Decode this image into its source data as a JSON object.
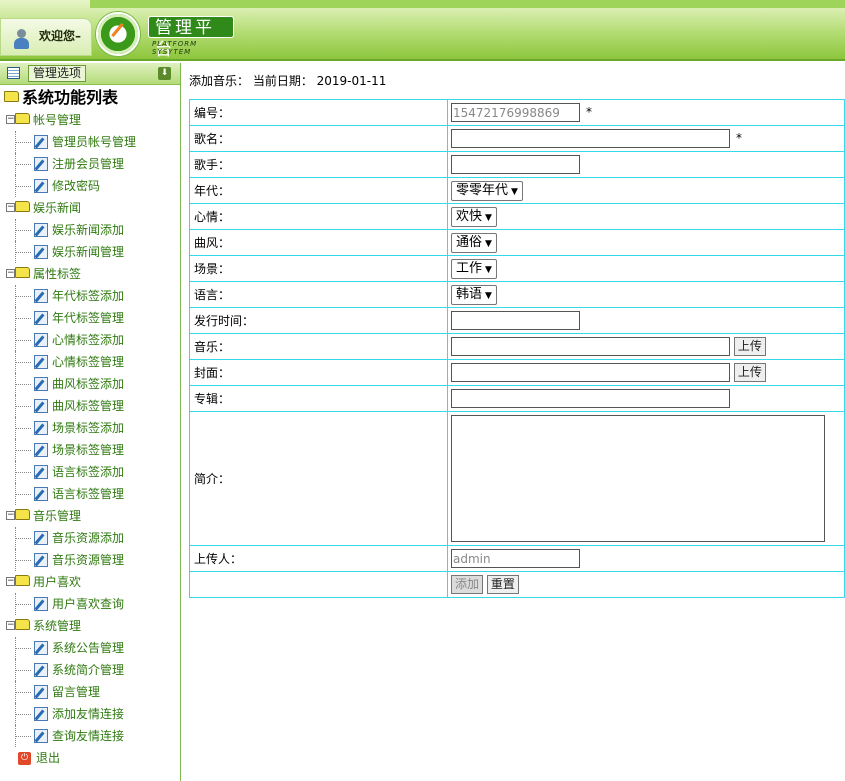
{
  "header": {
    "welcome": "欢迎您–",
    "brand_title": "管理平台",
    "brand_subtitle": "PLATFORM SYSYTEM"
  },
  "sidebar": {
    "title": "管理选项",
    "root": "系统功能列表",
    "groups": [
      {
        "label": "帐号管理",
        "items": [
          "管理员帐号管理",
          "注册会员管理",
          "修改密码"
        ]
      },
      {
        "label": "娱乐新闻",
        "items": [
          "娱乐新闻添加",
          "娱乐新闻管理"
        ]
      },
      {
        "label": "属性标签",
        "items": [
          "年代标签添加",
          "年代标签管理",
          "心情标签添加",
          "心情标签管理",
          "曲风标签添加",
          "曲风标签管理",
          "场景标签添加",
          "场景标签管理",
          "语言标签添加",
          "语言标签管理"
        ]
      },
      {
        "label": "音乐管理",
        "items": [
          "音乐资源添加",
          "音乐资源管理"
        ]
      },
      {
        "label": "用户喜欢",
        "items": [
          "用户喜欢查询"
        ]
      },
      {
        "label": "系统管理",
        "items": [
          "系统公告管理",
          "系统简介管理",
          "留言管理",
          "添加友情连接",
          "查询友情连接"
        ]
      }
    ],
    "exit": "退出"
  },
  "main": {
    "header": "添加音乐： 当前日期： 2019-01-11",
    "form": {
      "id_label": "编号：",
      "id_value": "15472176998869",
      "required_mark": "*",
      "name_label": "歌名：",
      "singer_label": "歌手：",
      "era_label": "年代：",
      "era_value": "零零年代",
      "mood_label": "心情：",
      "mood_value": "欢快",
      "genre_label": "曲风：",
      "genre_value": "通俗",
      "scene_label": "场景：",
      "scene_value": "工作",
      "lang_label": "语言：",
      "lang_value": "韩语",
      "release_label": "发行时间：",
      "music_label": "音乐：",
      "upload_label": "上传",
      "cover_label": "封面：",
      "album_label": "专辑：",
      "intro_label": "简介：",
      "uploader_label": "上传人：",
      "uploader_value": "admin",
      "add_button": "添加",
      "reset_button": "重置"
    }
  }
}
